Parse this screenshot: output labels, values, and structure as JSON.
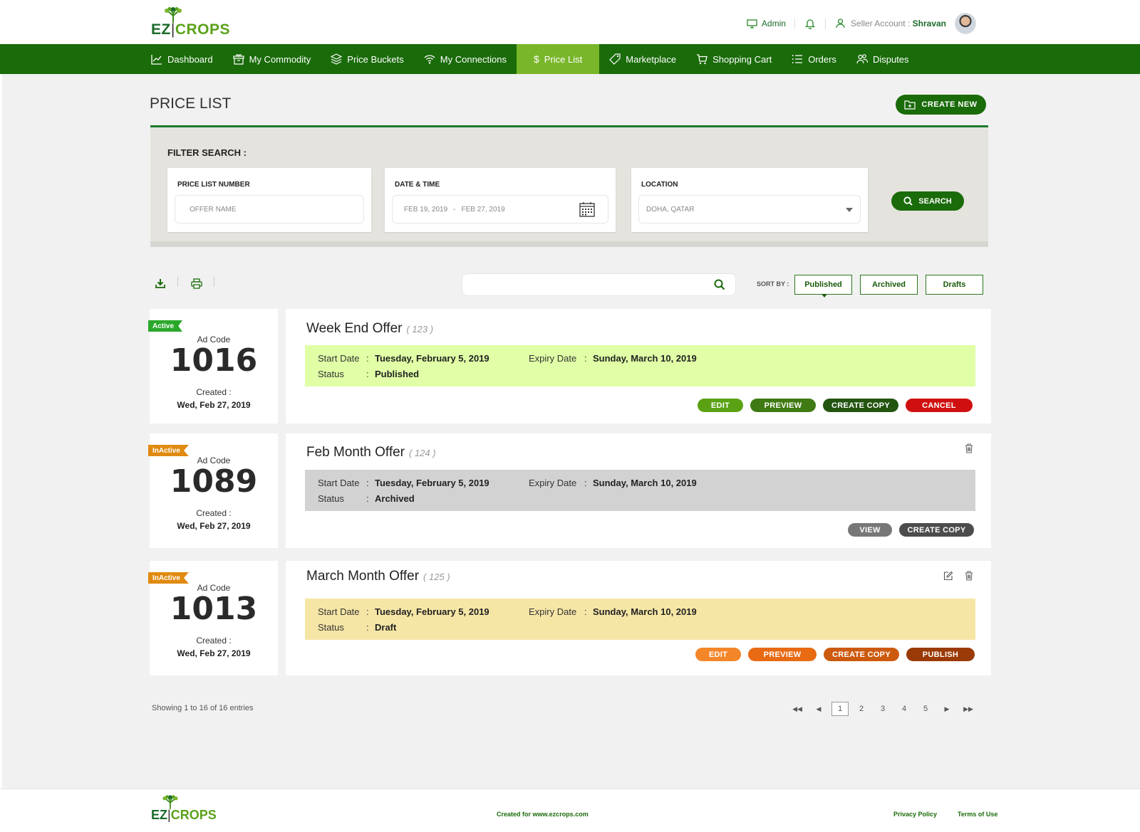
{
  "brand": {
    "ez": "EZ",
    "bar": "|",
    "crops": "CROPS"
  },
  "header": {
    "admin_label": "Admin",
    "seller_label": "Seller Account : ",
    "seller_name": "Shravan"
  },
  "nav": [
    {
      "label": "Dashboard",
      "icon": "chart-icon"
    },
    {
      "label": "My Commodity",
      "icon": "box-icon"
    },
    {
      "label": "Price Buckets",
      "icon": "layers-icon"
    },
    {
      "label": "My Connections",
      "icon": "wifi-icon"
    },
    {
      "label": "Price List",
      "icon": "dollar-icon",
      "active": true
    },
    {
      "label": "Marketplace",
      "icon": "tag-icon"
    },
    {
      "label": "Shopping Cart",
      "icon": "cart-icon"
    },
    {
      "label": "Orders",
      "icon": "list-icon"
    },
    {
      "label": "Disputes",
      "icon": "users-icon"
    }
  ],
  "page": {
    "title": "PRICE LIST",
    "create_new": "CREATE NEW"
  },
  "filter": {
    "title": "FILTER SEARCH :",
    "price_list_label": "PRICE LIST NUMBER",
    "price_list_placeholder": "OFFER NAME",
    "date_label": "DATE & TIME",
    "date_from": "FEB 19, 2019",
    "date_sep": "-",
    "date_to": "FEB 27, 2019",
    "location_label": "LOCATION",
    "location_value": "DOHA, QATAR",
    "search_label": "SEARCH"
  },
  "sort": {
    "label": "SORT BY :",
    "options": [
      "Published",
      "Archived",
      "Drafts"
    ],
    "selected": "Published"
  },
  "labels": {
    "ad_code": "Ad Code",
    "created": "Created :",
    "start_date": "Start Date",
    "expiry_date": "Expiry Date",
    "status": "Status",
    "colon": ":"
  },
  "offers": [
    {
      "tag": "Active",
      "code": "1016",
      "created": "Wed, Feb 27, 2019",
      "title": "Week End Offer",
      "num": "( 123 )",
      "start": "Tuesday, February 5, 2019",
      "expiry": "Sunday, March 10, 2019",
      "status": "Published",
      "info_bg": "#e0ffa6",
      "actions": [
        {
          "label": "EDIT",
          "color": "#5aa214"
        },
        {
          "label": "PREVIEW",
          "color": "#3f7a12"
        },
        {
          "label": "CREATE COPY",
          "color": "#235410"
        },
        {
          "label": "CANCEL",
          "color": "#d01010"
        }
      ]
    },
    {
      "tag": "InActive",
      "code": "1089",
      "created": "Wed, Feb 27, 2019",
      "title": "Feb Month Offer",
      "num": "( 124 )",
      "start": "Tuesday, February 5, 2019",
      "expiry": "Sunday, March 10, 2019",
      "status": "Archived",
      "info_bg": "#d2d2d2",
      "actions": [
        {
          "label": "VIEW",
          "color": "#777777"
        },
        {
          "label": "CREATE COPY",
          "color": "#4c4c4c"
        }
      ]
    },
    {
      "tag": "InActive",
      "code": "1013",
      "created": "Wed, Feb 27, 2019",
      "title": "March Month Offer",
      "num": "( 125 )",
      "start": "Tuesday, February 5, 2019",
      "expiry": "Sunday, March 10, 2019",
      "status": "Draft",
      "info_bg": "#f6e6a6",
      "actions": [
        {
          "label": "EDIT",
          "color": "#f4862a"
        },
        {
          "label": "PREVIEW",
          "color": "#e86a12"
        },
        {
          "label": "CREATE COPY",
          "color": "#cc5a0e"
        },
        {
          "label": "PUBLISH",
          "color": "#9a3a06"
        }
      ]
    }
  ],
  "pagination": {
    "showing": "Showing 1 to 16 of 16 entries",
    "pages": [
      "1",
      "2",
      "3",
      "4",
      "5"
    ],
    "current": "1"
  },
  "footer": {
    "created": "Created for www.ezcrops.com",
    "privacy": "Privacy Policy",
    "terms": "Terms of Use"
  }
}
